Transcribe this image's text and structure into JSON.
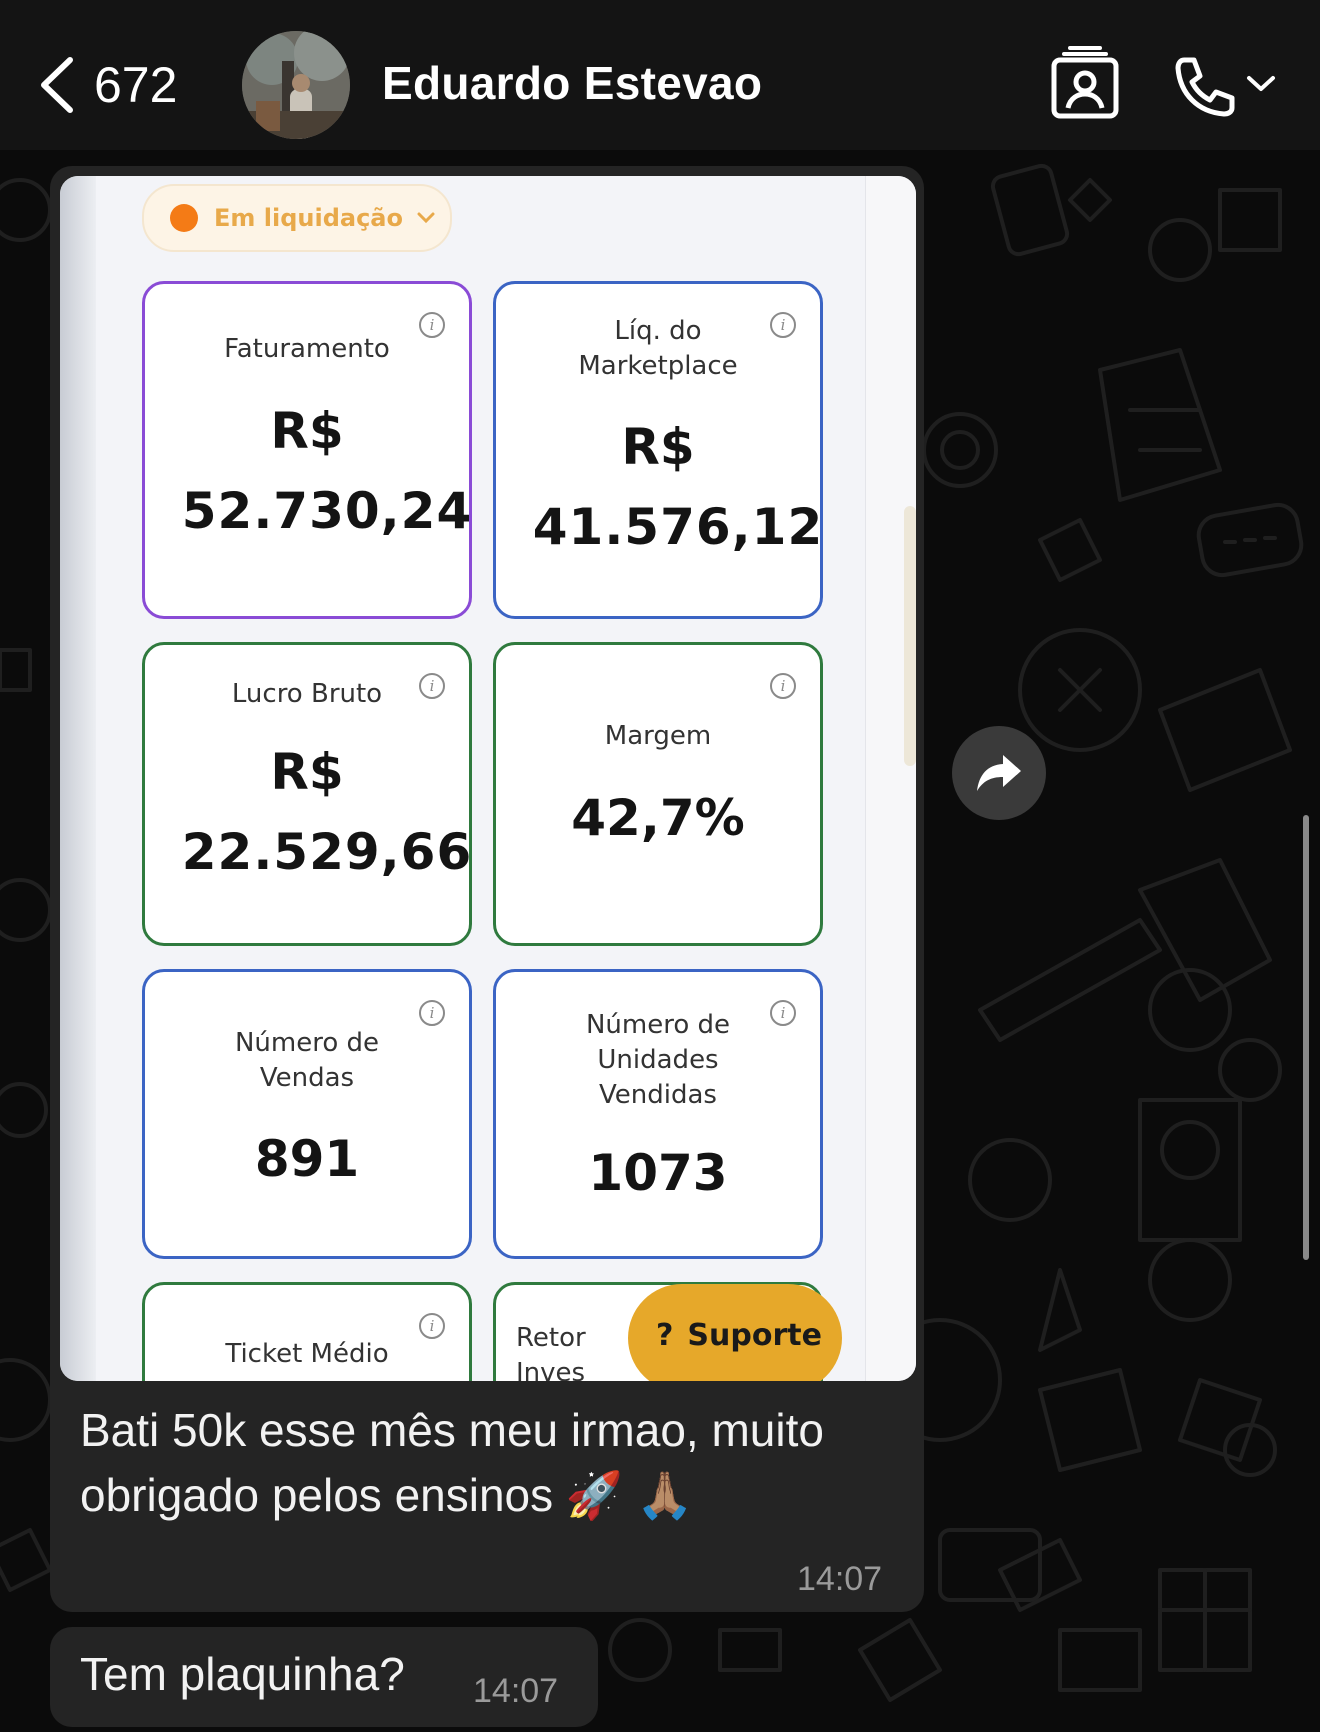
{
  "header": {
    "back_count": "672",
    "contact_name": "Eduardo Estevao"
  },
  "colors": {
    "accent": "#e6a82a",
    "bubble": "#242424",
    "background": "#0b0b0b"
  },
  "image": {
    "status": "Em liquidação",
    "cards": [
      {
        "label": "Faturamento",
        "currency": "R$",
        "value": "52.730,24"
      },
      {
        "label": "Líq. do Marketplace",
        "currency": "R$",
        "value": "41.576,12"
      },
      {
        "label": "Lucro Bruto",
        "currency": "R$",
        "value": "22.529,66"
      },
      {
        "label": "Margem",
        "value": "42,7%"
      },
      {
        "label": "Número de Vendas",
        "value": "891"
      },
      {
        "label": "Número de Unidades Vendidas",
        "value": "1073"
      },
      {
        "label": "Ticket Médio"
      },
      {
        "label": "Retor Inves"
      }
    ],
    "support_label": "Suporte",
    "support_icon": "question-icon"
  },
  "messages": [
    {
      "text": "Bati 50k esse mês meu irmao, muito obrigado pelos ensinos 🚀 🙏🏽",
      "time": "14:07"
    },
    {
      "text": "Tem plaquinha?",
      "time": "14:07"
    }
  ],
  "icons": [
    "back-chevron-icon",
    "contact-card-icon",
    "phone-icon",
    "chevron-down-icon",
    "forward-icon",
    "info-icon"
  ]
}
